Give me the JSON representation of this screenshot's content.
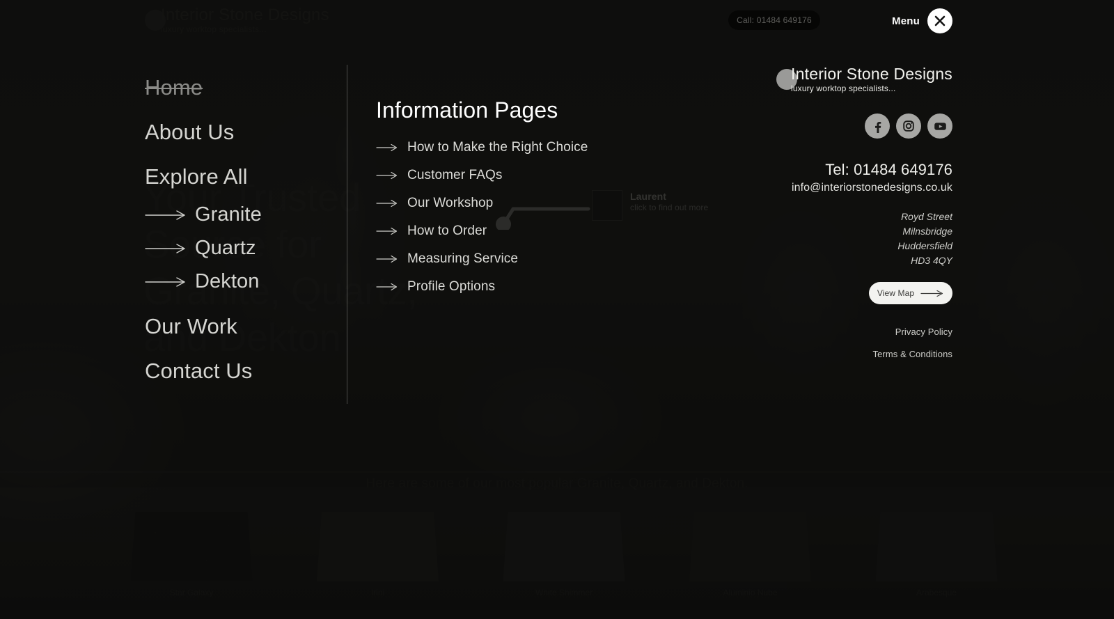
{
  "header": {
    "logo_name": "Interior Stone Designs",
    "logo_tagline": "luxury worktop specialists...",
    "call_pill": "Call: 01484 649176",
    "menu_label": "Menu",
    "close_icon": "close-x-icon"
  },
  "hero": {
    "headline": "Your Trusted\nSource for\nGranite, Quartz,\nand Dekton",
    "subline": "Here are some of our most popular Granite, Quartz, and Dekton."
  },
  "nav": {
    "items": [
      {
        "label": "Home",
        "active": true
      },
      {
        "label": "About Us",
        "active": false
      },
      {
        "label": "Explore All",
        "active": false
      }
    ],
    "sub_items": [
      {
        "label": "Granite"
      },
      {
        "label": "Quartz"
      },
      {
        "label": "Dekton"
      }
    ],
    "items_after": [
      {
        "label": "Our Work",
        "active": false
      },
      {
        "label": "Contact Us",
        "active": false
      }
    ]
  },
  "info": {
    "title": "Information Pages",
    "links": [
      "How to Make the Right Choice",
      "Customer FAQs",
      "Our Workshop",
      "How to Order",
      "Measuring Service",
      "Profile Options"
    ]
  },
  "callout": {
    "name": "Laurent",
    "hint": "click to find out more",
    "swatch_color": "#0a0a0a"
  },
  "panel": {
    "logo_name": "Interior Stone Designs",
    "logo_tagline": "luxury worktop specialists...",
    "socials": [
      {
        "name": "facebook-icon"
      },
      {
        "name": "instagram-icon"
      },
      {
        "name": "youtube-icon"
      }
    ],
    "tel": "Tel: 01484 649176",
    "email": "info@interiorstonedesigns.co.uk",
    "address": [
      "Royd Street",
      "Milnsbridge",
      "Huddersfield",
      "HD3 4QY"
    ],
    "view_map": "View Map",
    "legal": [
      "Privacy Policy",
      "Terms & Conditions"
    ]
  },
  "samples": [
    {
      "label": "Star Galaxy",
      "color": "#0c0c0c"
    },
    {
      "label": "Irini",
      "color": "#1f1f1d"
    },
    {
      "label": "White Shimmer",
      "color": "#222220"
    },
    {
      "label": "Aluminio Nube",
      "color": "#1a1a18"
    },
    {
      "label": "Arabesque",
      "color": "#1d1d1b"
    }
  ],
  "colors": {
    "background": "#151513",
    "overlay": "rgba(12,12,11,0.80)",
    "text_primary": "#d5d5d1",
    "text_muted": "#8b8b88",
    "accent_white": "#ffffff",
    "social_circle": "#a7a7a4",
    "button_light": "#f3f3f0"
  }
}
